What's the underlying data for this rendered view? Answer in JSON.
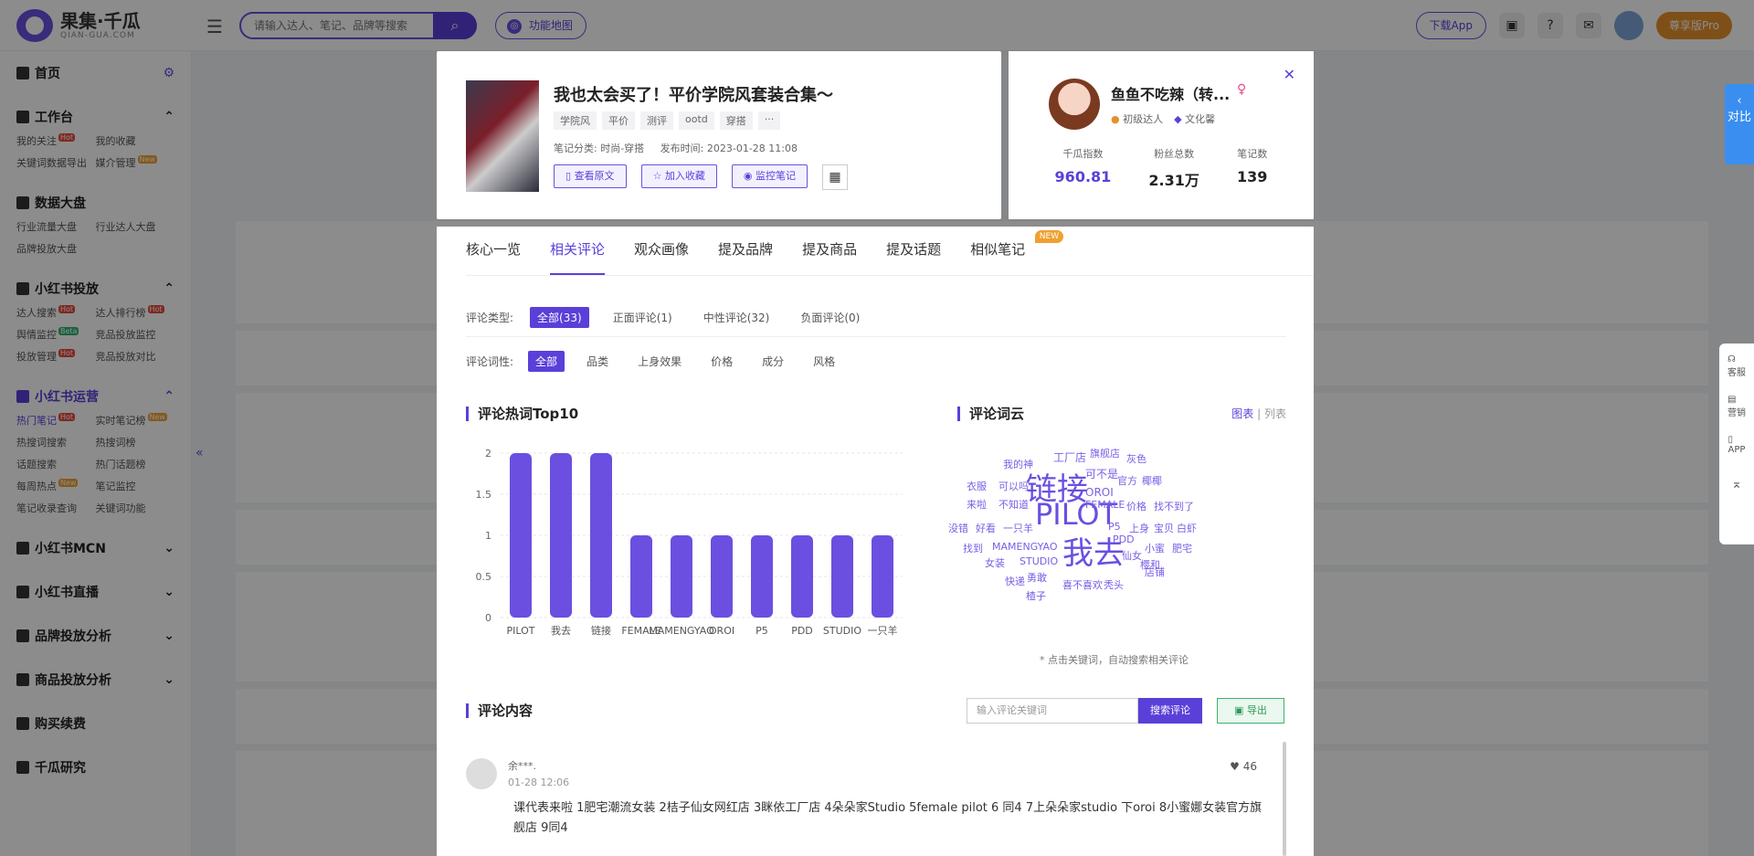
{
  "header": {
    "logo_text": "果集·千瓜",
    "logo_sub": "QIAN-GUA.COM",
    "search_placeholder": "请输入达人、笔记、品牌等搜索",
    "func_map": "功能地图",
    "download_app": "下载App",
    "pro_label": "尊享版Pro"
  },
  "sidebar": {
    "home": "首页",
    "workbench": {
      "title": "工作台",
      "items": [
        "我的关注",
        "我的收藏",
        "关键词数据导出",
        "媒介管理"
      ]
    },
    "databoard": {
      "title": "数据大盘",
      "items": [
        "行业流量大盘",
        "行业达人大盘",
        "品牌投放大盘"
      ]
    },
    "redbook_ads": {
      "title": "小红书投放",
      "items": [
        "达人搜索",
        "达人排行榜",
        "舆情监控",
        "竞品投放监控",
        "投放管理",
        "竞品投放对比"
      ]
    },
    "redbook_ops": {
      "title": "小红书运营",
      "items": [
        "热门笔记",
        "实时笔记榜",
        "热搜词搜索",
        "热搜词榜",
        "话题搜索",
        "热门话题榜",
        "每周热点",
        "笔记监控",
        "笔记收录查询",
        "关键词功能"
      ]
    },
    "mcn": "小红书MCN",
    "live": "小红书直播",
    "brand": "品牌投放分析",
    "goods": "商品投放分析",
    "renew": "购买续费",
    "more": "千瓜研究"
  },
  "note": {
    "title": "我也太会买了！平价学院风套装合集～",
    "tags": [
      "学院风",
      "平价",
      "测评",
      "ootd",
      "穿搭",
      "···"
    ],
    "category": "笔记分类: 时尚-穿搭",
    "publish": "发布时间: 2023-01-28 11:08",
    "btn_view": "查看原文",
    "btn_fav": "加入收藏",
    "btn_monitor": "监控笔记"
  },
  "user": {
    "name": "鱼鱼不吃辣（转...",
    "level": "初级达人",
    "tag": "文化馨",
    "stats": [
      {
        "label": "千瓜指数",
        "value": "960.81"
      },
      {
        "label": "粉丝总数",
        "value": "2.31万"
      },
      {
        "label": "笔记数",
        "value": "139"
      }
    ]
  },
  "tabs": [
    "核心一览",
    "相关评论",
    "观众画像",
    "提及品牌",
    "提及商品",
    "提及话题",
    "相似笔记"
  ],
  "tab_new": "NEW",
  "comment_type": {
    "label": "评论类型:",
    "options": [
      "全部(33)",
      "正面评论(1)",
      "中性评论(32)",
      "负面评论(0)"
    ]
  },
  "comment_prop": {
    "label": "评论词性:",
    "options": [
      "全部",
      "品类",
      "上身效果",
      "价格",
      "成分",
      "风格"
    ]
  },
  "hot_title": "评论热词Top10",
  "cloud_title": "评论词云",
  "cloud_toggle": {
    "chart": "图表",
    "list": "列表"
  },
  "cloud_note": "* 点击关键词，自动搜索相关评论",
  "cloud_words": [
    "我的神",
    "工厂店",
    "旗舰店",
    "灰色",
    "衣服",
    "可以吗",
    "可不是",
    "官方",
    "椰椰",
    "来啦",
    "不知道",
    "链接",
    "OROI",
    "价格",
    "找不到了",
    "没错",
    "好看",
    "一只羊",
    "PILOT",
    "FEMALE",
    "P5",
    "上身",
    "宝贝",
    "白虾",
    "找到",
    "MAMENGYAO",
    "PDD",
    "仙女",
    "小蜜",
    "肥宅",
    "女装",
    "STUDIO",
    "我去",
    "店铺",
    "樱和",
    "快递",
    "勇敢",
    "喜不喜欢",
    "秃头",
    "楂子"
  ],
  "comments_title": "评论内容",
  "comment_search_placeholder": "输入评论关键词",
  "comment_search_btn": "搜索评论",
  "export_btn": "导出",
  "comment": {
    "user": "余***.",
    "time": "01-28 12:06",
    "likes": "46",
    "text": "课代表来啦 1肥宅潮流女装 2桔子仙女网红店 3眯依工厂店 4朵朵家Studio 5female pilot 6 同4 7上朵朵家studio 下oroi 8小蜜娜女装官方旗舰店 9同4"
  },
  "right_tools": [
    "客服",
    "营销",
    "APP"
  ],
  "blue_tab": "对比",
  "chart_data": {
    "type": "bar",
    "categories": [
      "PILOT",
      "我去",
      "链接",
      "FEMALE",
      "MAMENGYAO",
      "OROI",
      "P5",
      "PDD",
      "STUDIO",
      "一只羊"
    ],
    "values": [
      2,
      2,
      2,
      1,
      1,
      1,
      1,
      1,
      1,
      1
    ],
    "yticks": [
      "0",
      "0.5",
      "1",
      "1.5",
      "2"
    ],
    "ylim": [
      0,
      2
    ],
    "title": "评论热词Top10"
  },
  "colors": {
    "accent": "#5b3fd9",
    "bar": "#6b4fe0"
  }
}
